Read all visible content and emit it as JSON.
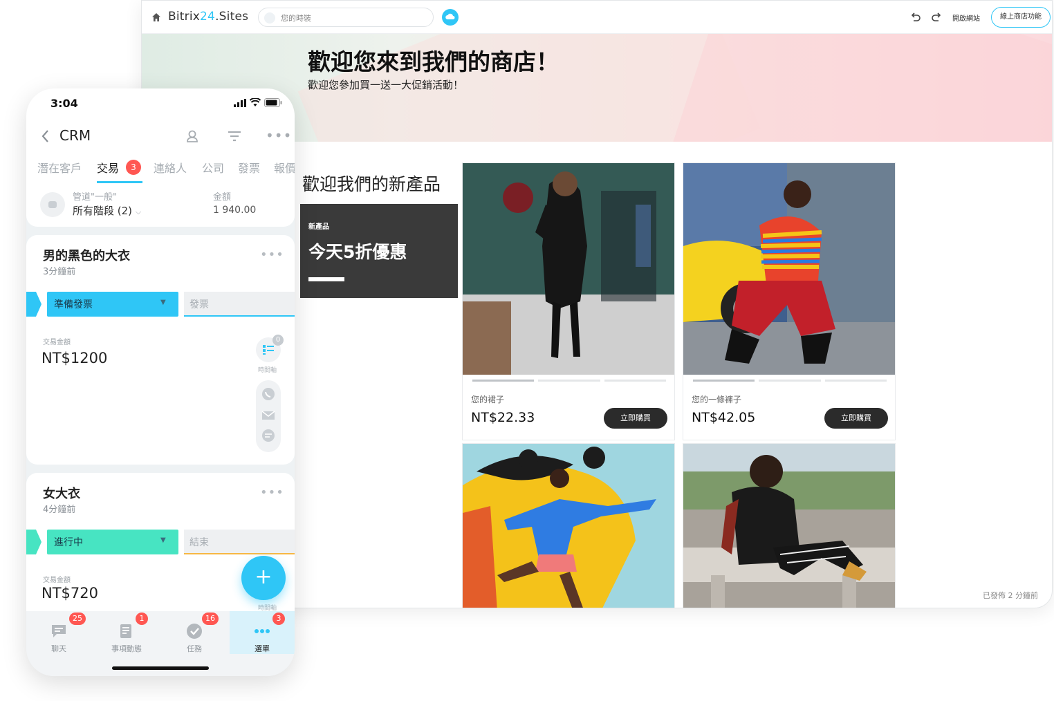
{
  "browser": {
    "brand_prefix": "Bitrix",
    "brand_number": "24",
    "brand_suffix": ".Sites",
    "url_text": "您的時裝",
    "open_site": "開啟網站",
    "store_features": "線上商店功能"
  },
  "hero": {
    "title": "歡迎您來到我們的商店！",
    "subtitle": "歡迎您參加買一送一大促銷活動！"
  },
  "new_products": {
    "title": "歡迎我們的新產品",
    "promo_tag": "新產品",
    "promo_text": "今天5折優惠"
  },
  "products": [
    {
      "name": "您的裙子",
      "price": "NT$22.33",
      "buy_label": "立即購買"
    },
    {
      "name": "您的一條褲子",
      "price": "NT$42.05",
      "buy_label": "立即購買"
    }
  ],
  "published": "已發佈 2 分鐘前",
  "phone": {
    "time": "3:04",
    "title": "CRM",
    "tabs": [
      "潛在客戶",
      "交易",
      "連絡人",
      "公司",
      "發票",
      "報價"
    ],
    "deals_badge": "3",
    "pipeline_label": "管道\"一般\"",
    "pipeline_value": "所有階段 (2)",
    "amount_label": "金額",
    "amount_value": "1 940.00",
    "deals": [
      {
        "title": "男的黑色的大衣",
        "time": "3分鐘前",
        "stage": "準備發票",
        "next_stage": "發票",
        "amount_label": "交易金額",
        "amount": "NT$1200",
        "timeline_label": "時間軸",
        "timeline_count": "0"
      },
      {
        "title": "女大衣",
        "time": "4分鐘前",
        "stage": "進行中",
        "next_stage": "結束",
        "amount_label": "交易金額",
        "amount": "NT$720",
        "timeline_label": "時間軸"
      }
    ],
    "fab": "+",
    "tabbar": [
      {
        "label": "聊天",
        "badge": "25"
      },
      {
        "label": "事項動態",
        "badge": "1"
      },
      {
        "label": "任務",
        "badge": "16"
      },
      {
        "label": "選單",
        "badge": "3"
      }
    ]
  },
  "colors": {
    "accent": "#2fc6f6",
    "stage_invoice": "#2fc6f6",
    "stage_progress": "#47e4c2",
    "badge": "#ff5752",
    "promo_bg": "#3a3a3a"
  }
}
